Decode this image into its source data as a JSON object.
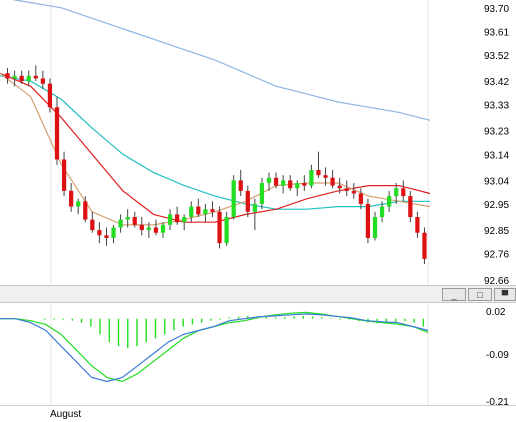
{
  "window": {
    "minimize_label": "_",
    "restore_label": "□",
    "maximize_label": "▀"
  },
  "colors": {
    "bull": "#22dd22",
    "bear": "#dd1111",
    "wick": "#444444",
    "ma_slow": "#8fb5e0",
    "ma_mid": "#22c0c0",
    "ma_red": "#e02020",
    "ma_tan": "#d4a070",
    "ma_blue": "#3a7ad8",
    "macd_line": "#3a7ad8",
    "signal_line": "#22dd22",
    "hist": "#22dd22",
    "grid": "#e6e6e6"
  },
  "chart_data": [
    {
      "type": "candlestick",
      "y_ticks": [
        "93.70",
        "93.61",
        "93.52",
        "93.42",
        "93.33",
        "93.23",
        "93.14",
        "93.04",
        "92.95",
        "92.85",
        "92.76",
        "92.66"
      ],
      "ylim": [
        92.64,
        93.73
      ],
      "ohlc": [
        [
          93.45,
          93.47,
          93.41,
          93.43
        ],
        [
          93.43,
          93.46,
          93.4,
          93.44
        ],
        [
          93.44,
          93.46,
          93.41,
          93.42
        ],
        [
          93.42,
          93.46,
          93.4,
          93.44
        ],
        [
          93.44,
          93.48,
          93.42,
          93.43
        ],
        [
          93.43,
          93.46,
          93.39,
          93.41
        ],
        [
          93.41,
          93.43,
          93.3,
          93.32
        ],
        [
          93.32,
          93.36,
          93.1,
          93.12
        ],
        [
          93.12,
          93.15,
          92.98,
          93.0
        ],
        [
          93.0,
          93.03,
          92.92,
          92.94
        ],
        [
          92.94,
          92.97,
          92.91,
          92.96
        ],
        [
          92.96,
          92.98,
          92.88,
          92.89
        ],
        [
          92.89,
          92.92,
          92.84,
          92.85
        ],
        [
          92.85,
          92.88,
          92.8,
          92.83
        ],
        [
          92.83,
          92.86,
          92.79,
          92.82
        ],
        [
          92.82,
          92.87,
          92.8,
          92.86
        ],
        [
          92.86,
          92.91,
          92.84,
          92.89
        ],
        [
          92.89,
          92.93,
          92.86,
          92.9
        ],
        [
          92.9,
          92.92,
          92.86,
          92.87
        ],
        [
          92.87,
          92.9,
          92.83,
          92.85
        ],
        [
          92.85,
          92.88,
          92.82,
          92.86
        ],
        [
          92.86,
          92.89,
          92.83,
          92.84
        ],
        [
          92.84,
          92.88,
          92.82,
          92.87
        ],
        [
          92.87,
          92.93,
          92.85,
          92.91
        ],
        [
          92.91,
          92.94,
          92.87,
          92.88
        ],
        [
          92.88,
          92.91,
          92.85,
          92.9
        ],
        [
          92.9,
          92.96,
          92.88,
          92.94
        ],
        [
          92.94,
          92.97,
          92.9,
          92.91
        ],
        [
          92.91,
          92.95,
          92.88,
          92.93
        ],
        [
          92.93,
          92.96,
          92.9,
          92.92
        ],
        [
          92.92,
          92.94,
          92.78,
          92.8
        ],
        [
          92.8,
          92.92,
          92.79,
          92.9
        ],
        [
          92.9,
          93.06,
          92.89,
          93.04
        ],
        [
          93.04,
          93.08,
          92.98,
          93.0
        ],
        [
          93.0,
          93.02,
          92.9,
          92.92
        ],
        [
          92.92,
          92.97,
          92.85,
          92.95
        ],
        [
          92.95,
          93.05,
          92.93,
          93.03
        ],
        [
          93.03,
          93.07,
          93.0,
          93.05
        ],
        [
          93.05,
          93.07,
          93.01,
          93.02
        ],
        [
          93.02,
          93.06,
          92.99,
          93.04
        ],
        [
          93.04,
          93.06,
          93.0,
          93.01
        ],
        [
          93.01,
          93.04,
          92.98,
          93.03
        ],
        [
          93.03,
          93.06,
          93.0,
          93.02
        ],
        [
          93.02,
          93.1,
          93.01,
          93.08
        ],
        [
          93.08,
          93.15,
          93.05,
          93.06
        ],
        [
          93.06,
          93.09,
          93.02,
          93.05
        ],
        [
          93.05,
          93.08,
          93.01,
          93.02
        ],
        [
          93.02,
          93.05,
          92.99,
          93.01
        ],
        [
          93.01,
          93.04,
          92.98,
          93.0
        ],
        [
          93.0,
          93.03,
          92.97,
          92.99
        ],
        [
          92.99,
          93.01,
          92.93,
          92.95
        ],
        [
          92.95,
          92.97,
          92.8,
          92.82
        ],
        [
          92.82,
          92.92,
          92.81,
          92.9
        ],
        [
          92.9,
          92.96,
          92.88,
          92.94
        ],
        [
          92.94,
          93.0,
          92.92,
          92.98
        ],
        [
          92.98,
          93.03,
          92.95,
          93.01
        ],
        [
          93.01,
          93.04,
          92.96,
          92.98
        ],
        [
          92.98,
          93.0,
          92.88,
          92.9
        ],
        [
          92.9,
          92.92,
          92.82,
          92.84
        ],
        [
          92.84,
          92.86,
          92.72,
          92.74
        ]
      ],
      "ma_series": [
        {
          "color_key": "ma_slow",
          "values": [
            93.74,
            93.72,
            93.7,
            93.66,
            93.62,
            93.58,
            93.54,
            93.5,
            93.45,
            93.4,
            93.37,
            93.34,
            93.32,
            93.3,
            93.27
          ]
        },
        {
          "color_key": "ma_mid",
          "values": [
            93.44,
            93.42,
            93.35,
            93.24,
            93.14,
            93.07,
            93.02,
            92.98,
            92.95,
            92.93,
            92.93,
            92.94,
            92.94,
            92.96,
            92.96
          ]
        },
        {
          "color_key": "ma_red",
          "values": [
            93.45,
            93.4,
            93.28,
            93.14,
            93.0,
            92.91,
            92.88,
            92.88,
            92.91,
            92.93,
            92.97,
            93.0,
            93.02,
            93.02,
            92.99
          ]
        },
        {
          "color_key": "ma_tan",
          "values": [
            93.45,
            93.36,
            93.1,
            92.92,
            92.87,
            92.87,
            92.89,
            92.92,
            92.96,
            93.02,
            93.03,
            93.03,
            92.98,
            92.96,
            92.94
          ]
        }
      ]
    },
    {
      "type": "macd",
      "y_ticks": [
        "0.02",
        "-0.09",
        "-0.21"
      ],
      "ylim": [
        -0.22,
        0.04
      ],
      "histogram": [
        0.0,
        0.0,
        0.0,
        -0.005,
        -0.01,
        -0.02,
        -0.04,
        -0.06,
        -0.07,
        -0.075,
        -0.07,
        -0.06,
        -0.05,
        -0.04,
        -0.03,
        -0.02,
        -0.015,
        -0.01,
        -0.005,
        0.0,
        0.003,
        0.005,
        0.007,
        0.006,
        0.005,
        0.003,
        0.004,
        0.006,
        0.007,
        0.006,
        0.004,
        0.002,
        0.0,
        -0.002,
        -0.006,
        -0.01,
        -0.012,
        -0.01,
        -0.008,
        -0.006,
        -0.01,
        -0.02
      ],
      "macd": [
        0.0,
        0.0,
        -0.01,
        -0.03,
        -0.07,
        -0.11,
        -0.15,
        -0.16,
        -0.15,
        -0.12,
        -0.09,
        -0.06,
        -0.04,
        -0.03,
        -0.02,
        -0.005,
        0.0,
        0.005,
        0.007,
        0.01,
        0.012,
        0.01,
        0.006,
        0.002,
        -0.005,
        -0.008,
        -0.01,
        -0.02,
        -0.03
      ],
      "signal": [
        0.0,
        0.0,
        -0.005,
        -0.015,
        -0.04,
        -0.08,
        -0.12,
        -0.15,
        -0.16,
        -0.14,
        -0.11,
        -0.08,
        -0.05,
        -0.03,
        -0.02,
        -0.01,
        -0.005,
        0.004,
        0.01,
        0.014,
        0.016,
        0.012,
        0.006,
        0.0,
        -0.006,
        -0.01,
        -0.014,
        -0.02,
        -0.035
      ]
    }
  ],
  "x_axis": {
    "labels": [
      "August"
    ]
  }
}
